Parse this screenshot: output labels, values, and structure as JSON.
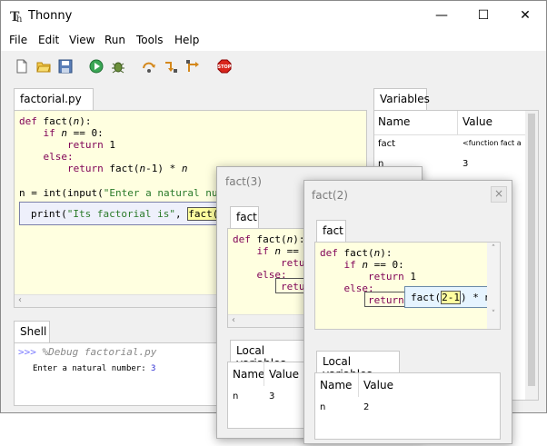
{
  "window": {
    "title": "Thonny",
    "minimize": "—",
    "maximize": "☐",
    "close": "✕"
  },
  "menu": [
    "File",
    "Edit",
    "View",
    "Run",
    "Tools",
    "Help"
  ],
  "editor": {
    "tab_label": "factorial.py",
    "tab_close": "×",
    "lines": [
      {
        "a": "def ",
        "b": "fact(",
        "c": "n",
        "d": "):"
      },
      {
        "a": "    if ",
        "b": "n",
        "c": " == 0:"
      },
      {
        "a": "        return ",
        "b": "1"
      },
      {
        "a": "    else:"
      },
      {
        "a": "        return ",
        "b": "fact(",
        "c": "n",
        "d": "-1) * ",
        "e": "n"
      },
      {
        "a": "n = int(input(",
        "b": "\"Enter a natural number"
      }
    ],
    "print_line": {
      "pre": "print(",
      "str": "\"Its factorial is\"",
      "mid": ", ",
      "call": "fact(3)",
      "post": ")"
    }
  },
  "shell": {
    "tab_label": "Shell",
    "prompt": ">>>",
    "command": " %Debug factorial.py",
    "output_label": "Enter a natural number: ",
    "output_value": "3"
  },
  "variables": {
    "tab_label": "Variables",
    "col_name": "Name",
    "col_value": "Value",
    "rows": [
      {
        "name": "fact",
        "value": "<function fact a"
      },
      {
        "name": "n",
        "value": "3"
      }
    ]
  },
  "frame3": {
    "title": "fact(3)",
    "tab_label": "fact",
    "lines": [
      {
        "a": "def ",
        "b": "fact(",
        "c": "n",
        "d": "):"
      },
      {
        "a": "    if ",
        "b": "n",
        "c": " == 0"
      },
      {
        "a": "        retur"
      },
      {
        "a": "    else:"
      },
      {
        "a": "        retur"
      }
    ],
    "locals_label": "Local variables",
    "col_name": "Name",
    "col_value": "Value",
    "row": {
      "name": "n",
      "value": "3"
    }
  },
  "frame2": {
    "title": "fact(2)",
    "close": "×",
    "tab_label": "fact",
    "lines": [
      {
        "a": "def ",
        "b": "fact(",
        "c": "n",
        "d": "):"
      },
      {
        "a": "    if ",
        "b": "n",
        "c": " == 0:"
      },
      {
        "a": "        return ",
        "b": "1"
      },
      {
        "a": "    else:"
      },
      {
        "a": "        return "
      }
    ],
    "tooltip": {
      "pre": "fact(",
      "hl": "2-1",
      "post": ") * n"
    },
    "locals_label": "Local variables",
    "col_name": "Name",
    "col_value": "Value",
    "row": {
      "name": "n",
      "value": "2"
    }
  },
  "icons": {
    "app": "app-icon",
    "new": "new-file-icon",
    "open": "open-file-icon",
    "save": "save-icon",
    "run": "run-icon",
    "debug": "debug-icon",
    "step_over": "step-over-icon",
    "step_into": "step-into-icon",
    "step_out": "step-out-icon",
    "stop": "stop-icon"
  },
  "colors": {
    "code_bg": "#ffffe0",
    "keyword": "#7f0055",
    "string": "#2a7a2a",
    "tooltip_bg": "#e6f4ff",
    "stop": "#d9261c"
  }
}
